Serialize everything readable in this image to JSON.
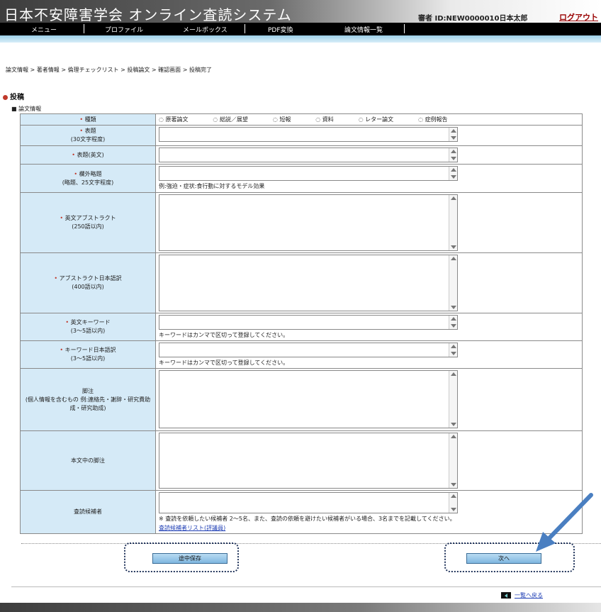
{
  "header": {
    "title": "日本不安障害学会 オンライン査読システム",
    "user_info": "審者 ID:NEW0000010日本太郎",
    "logout": "ログアウト"
  },
  "nav": [
    "メニュー",
    "プロファイル",
    "メールボックス",
    "PDF変換",
    "論文情報一覧"
  ],
  "breadcrumb": "論文情報 > 著者情報 > 倫理チェックリスト > 投稿論文 > 確認画面 > 投稿完了",
  "section": {
    "title": "投稿",
    "subtitle": "■ 論文情報"
  },
  "form": {
    "type": {
      "label": "種類",
      "options": [
        "原著論文",
        "総説／展望",
        "短報",
        "資料",
        "レター論文",
        "症例報告"
      ]
    },
    "title_ja": {
      "label": "表題",
      "sub": "(30文字程度)"
    },
    "title_en": {
      "label": "表題(英文)"
    },
    "running_title": {
      "label": "欄外略題",
      "sub": "(略題、25文字程度)",
      "hint": "例:強迫・症状:食行動に対するモデル効果"
    },
    "abstract_en": {
      "label": "英文アブストラクト",
      "sub": "(250語以内)"
    },
    "abstract_ja": {
      "label": "アブストラクト日本語訳",
      "sub": "(400語以内)"
    },
    "keywords_en": {
      "label": "英文キーワード",
      "sub": "(3〜5語以内)",
      "hint": "キーワードはカンマで区切って登録してください。"
    },
    "keywords_ja": {
      "label": "キーワード日本語訳",
      "sub": "(3〜5語以内)",
      "hint": "キーワードはカンマで区切って登録してください。"
    },
    "notes": {
      "label": "脚注",
      "sub": "(個人情報を含むもの 例:連絡先・謝辞・研究費助成・研究助成)"
    },
    "body_notes": {
      "label": "本文中の脚注"
    },
    "reviewer": {
      "label": "査読候補者",
      "hint": "※ 査読を依頼したい候補者 2〜5名、また、査読の依頼を避けたい候補者がいる場合、3名までを記載してください。",
      "link": "査読候補者リスト(評議員)"
    }
  },
  "buttons": {
    "save": "途中保存",
    "next": "次へ"
  },
  "footer": {
    "back": "一覧へ戻る"
  }
}
